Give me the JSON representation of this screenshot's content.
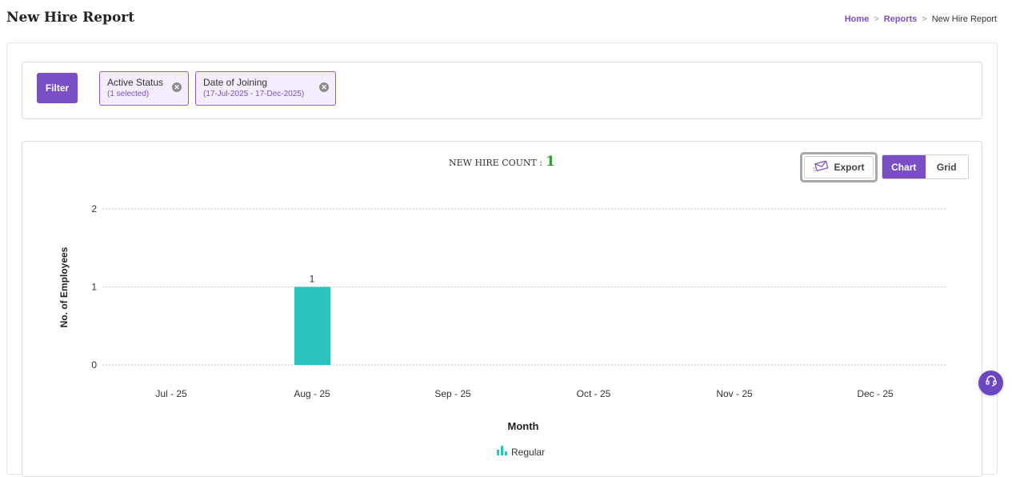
{
  "header": {
    "title": "New Hire Report"
  },
  "breadcrumb": {
    "home": "Home",
    "reports": "Reports",
    "current": "New Hire Report",
    "separator": ">"
  },
  "filters": {
    "button_label": "Filter",
    "chips": [
      {
        "title": "Active Status",
        "sub": "(1 selected)"
      },
      {
        "title": "Date of Joining",
        "sub": "(17-Jul-2025 - 17-Dec-2025)"
      }
    ]
  },
  "summary": {
    "label": "NEW HIRE COUNT :",
    "value": "1"
  },
  "toolbar": {
    "export_label": "Export",
    "chart_label": "Chart",
    "grid_label": "Grid",
    "active_view": "Chart"
  },
  "colors": {
    "accent": "#7b4fc4",
    "bar": "#2ac4bd",
    "count": "#2a9d2a"
  },
  "chart_data": {
    "type": "bar",
    "categories": [
      "Jul - 25",
      "Aug - 25",
      "Sep - 25",
      "Oct - 25",
      "Nov - 25",
      "Dec - 25"
    ],
    "series": [
      {
        "name": "Regular",
        "values": [
          0,
          1,
          0,
          0,
          0,
          0
        ]
      }
    ],
    "xlabel": "Month",
    "ylabel": "No. of Employees",
    "ylim": [
      0,
      2
    ],
    "yticks": [
      0,
      1,
      2
    ],
    "grid": true,
    "legend": "bottom"
  },
  "support": {
    "icon": "headset-icon"
  }
}
